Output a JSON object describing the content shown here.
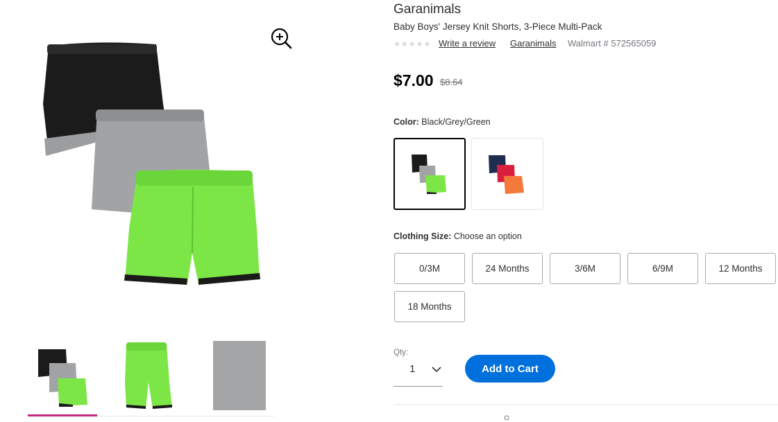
{
  "product": {
    "brand": "Garanimals",
    "title": "Baby Boys' Jersey Knit Shorts, 3-Piece Multi-Pack",
    "rating_stars": "★★★★★",
    "write_review": "Write a review",
    "brand_link": "Garanimals",
    "item_number": "Walmart # 572565059"
  },
  "price": {
    "current": "$7.00",
    "was": "$8.64"
  },
  "color": {
    "label": "Color:",
    "value": "Black/Grey/Green",
    "swatch_names": [
      "black-grey-green",
      "navy-red-orange"
    ]
  },
  "size": {
    "label": "Clothing Size:",
    "value": "Choose an option",
    "options": [
      "0/3M",
      "24 Months",
      "3/6M",
      "6/9M",
      "12 Months",
      "18 Months"
    ]
  },
  "quantity": {
    "label": "Qty:",
    "value": "1"
  },
  "cart": {
    "label": "Add to Cart"
  },
  "colors": {
    "accent_blue": "#0071dc",
    "thumb_indicator": "#c5287f",
    "shorts_black": "#1b1b1b",
    "shorts_grey": "#a2a3a5",
    "shorts_green": "#7ce647",
    "shorts_navy": "#1f2d50",
    "shorts_red": "#d81f3e",
    "shorts_orange": "#f37a3a"
  }
}
